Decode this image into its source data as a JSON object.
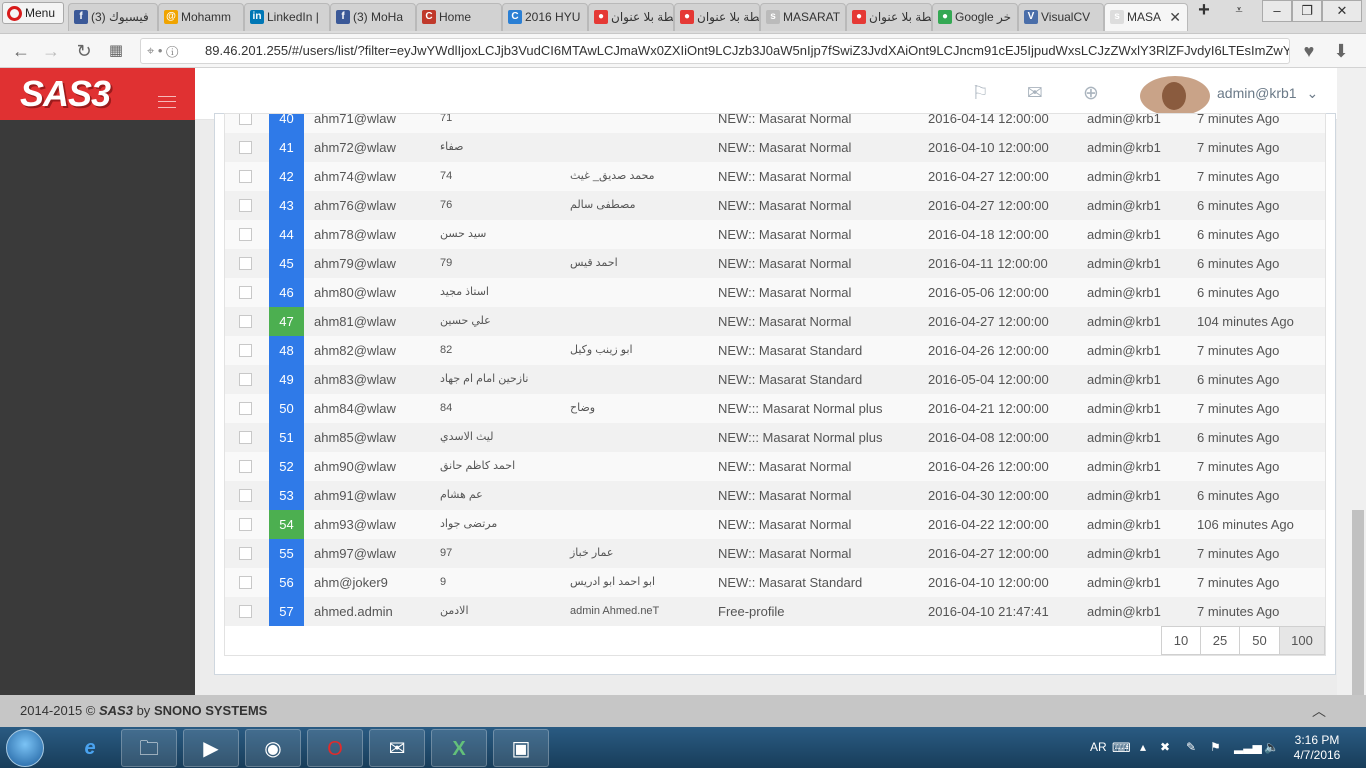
{
  "browser": {
    "menu_label": "Menu",
    "tabs": [
      {
        "title": "(3) فيسبوك",
        "icon": "facebook-icon",
        "color": "#3b5998",
        "glyph": "f"
      },
      {
        "title": "Mohamm",
        "icon": "at-icon",
        "color": "#f0a400",
        "glyph": "@"
      },
      {
        "title": "LinkedIn |",
        "icon": "linkedin-icon",
        "color": "#0077b5",
        "glyph": "in"
      },
      {
        "title": "(3) MoHa",
        "icon": "facebook-icon",
        "color": "#3b5998",
        "glyph": "f"
      },
      {
        "title": "Home",
        "icon": "cp-icon",
        "color": "#c0392b",
        "glyph": "C"
      },
      {
        "title": "2016 HYU",
        "icon": "c-icon",
        "color": "#2a7fd4",
        "glyph": "C"
      },
      {
        "title": "خريطة بلا عنوان",
        "icon": "map-pin-icon",
        "color": "#e53935",
        "glyph": "●"
      },
      {
        "title": "خريطة بلا عنوان",
        "icon": "map-pin-icon",
        "color": "#e53935",
        "glyph": "●"
      },
      {
        "title": "MASARAT",
        "icon": "sas-icon",
        "color": "#bbbbbb",
        "glyph": "s"
      },
      {
        "title": "خريطة بلا عنوان",
        "icon": "map-pin-icon",
        "color": "#e53935",
        "glyph": "●"
      },
      {
        "title": "Google خر",
        "icon": "google-maps-icon",
        "color": "#34a853",
        "glyph": "●"
      },
      {
        "title": "VisualCV",
        "icon": "visualcv-icon",
        "color": "#4a6ea9",
        "glyph": "V"
      },
      {
        "title": "MASA",
        "icon": "sas-icon",
        "color": "#dddddd",
        "glyph": "s"
      }
    ],
    "url": "89.46.201.255/#/users/list/?filter=eyJwYWdlIjoxLCJjb3VudCI6MTAwLCJmaWx0ZXIiOnt9LCJzb3J0aW5nIjp7fSwiZ3JvdXAiOnt9LCJncm91cEJ5IjpudWxsLCJzZWxlY3RlZFJvdyI6LTEsImZwYXJlbnQiO"
  },
  "app": {
    "logo": "SAS3",
    "username": "admin@krb1"
  },
  "colors": {
    "blue": "#2f7ae8",
    "green": "#4caf50"
  },
  "rows": [
    {
      "id": "40",
      "username": "ahm71@wlaw",
      "col3": "71",
      "col4": "",
      "profile": "NEW:: Masarat Normal",
      "expiration": "2016-04-14 12:00:00",
      "parent": "admin@krb1",
      "last": "7 minutes Ago",
      "status": "blue"
    },
    {
      "id": "41",
      "username": "ahm72@wlaw",
      "col3": "صفاء",
      "col4": "",
      "profile": "NEW:: Masarat Normal",
      "expiration": "2016-04-10 12:00:00",
      "parent": "admin@krb1",
      "last": "7 minutes Ago",
      "status": "blue"
    },
    {
      "id": "42",
      "username": "ahm74@wlaw",
      "col3": "74",
      "col4": "محمد صديق_ غيث",
      "profile": "NEW:: Masarat Normal",
      "expiration": "2016-04-27 12:00:00",
      "parent": "admin@krb1",
      "last": "7 minutes Ago",
      "status": "blue"
    },
    {
      "id": "43",
      "username": "ahm76@wlaw",
      "col3": "76",
      "col4": "مصطفى سالم",
      "profile": "NEW:: Masarat Normal",
      "expiration": "2016-04-27 12:00:00",
      "parent": "admin@krb1",
      "last": "6 minutes Ago",
      "status": "blue"
    },
    {
      "id": "44",
      "username": "ahm78@wlaw",
      "col3": "سيد حسن",
      "col4": "",
      "profile": "NEW:: Masarat Normal",
      "expiration": "2016-04-18 12:00:00",
      "parent": "admin@krb1",
      "last": "6 minutes Ago",
      "status": "blue"
    },
    {
      "id": "45",
      "username": "ahm79@wlaw",
      "col3": "79",
      "col4": "احمد قيس",
      "profile": "NEW:: Masarat Normal",
      "expiration": "2016-04-11 12:00:00",
      "parent": "admin@krb1",
      "last": "6 minutes Ago",
      "status": "blue"
    },
    {
      "id": "46",
      "username": "ahm80@wlaw",
      "col3": "استاذ مجيد",
      "col4": "",
      "profile": "NEW:: Masarat Normal",
      "expiration": "2016-05-06 12:00:00",
      "parent": "admin@krb1",
      "last": "6 minutes Ago",
      "status": "blue"
    },
    {
      "id": "47",
      "username": "ahm81@wlaw",
      "col3": "علي حسين",
      "col4": "",
      "profile": "NEW:: Masarat Normal",
      "expiration": "2016-04-27 12:00:00",
      "parent": "admin@krb1",
      "last": "104 minutes Ago",
      "status": "green"
    },
    {
      "id": "48",
      "username": "ahm82@wlaw",
      "col3": "82",
      "col4": "ابو زينب وكيل",
      "profile": "NEW:: Masarat Standard",
      "expiration": "2016-04-26 12:00:00",
      "parent": "admin@krb1",
      "last": "7 minutes Ago",
      "status": "blue"
    },
    {
      "id": "49",
      "username": "ahm83@wlaw",
      "col3": "نازحين امام ام جهاد",
      "col4": "",
      "profile": "NEW:: Masarat Standard",
      "expiration": "2016-05-04 12:00:00",
      "parent": "admin@krb1",
      "last": "6 minutes Ago",
      "status": "blue"
    },
    {
      "id": "50",
      "username": "ahm84@wlaw",
      "col3": "84",
      "col4": "وضاح",
      "profile": "NEW::: Masarat Normal plus",
      "expiration": "2016-04-21 12:00:00",
      "parent": "admin@krb1",
      "last": "7 minutes Ago",
      "status": "blue"
    },
    {
      "id": "51",
      "username": "ahm85@wlaw",
      "col3": "ليث الاسدي",
      "col4": "",
      "profile": "NEW::: Masarat Normal plus",
      "expiration": "2016-04-08 12:00:00",
      "parent": "admin@krb1",
      "last": "6 minutes Ago",
      "status": "blue"
    },
    {
      "id": "52",
      "username": "ahm90@wlaw",
      "col3": "احمد كاظم حانق",
      "col4": "",
      "profile": "NEW:: Masarat Normal",
      "expiration": "2016-04-26 12:00:00",
      "parent": "admin@krb1",
      "last": "7 minutes Ago",
      "status": "blue"
    },
    {
      "id": "53",
      "username": "ahm91@wlaw",
      "col3": "عم هشام",
      "col4": "",
      "profile": "NEW:: Masarat Normal",
      "expiration": "2016-04-30 12:00:00",
      "parent": "admin@krb1",
      "last": "6 minutes Ago",
      "status": "blue"
    },
    {
      "id": "54",
      "username": "ahm93@wlaw",
      "col3": "مرتضى جواد",
      "col4": "",
      "profile": "NEW:: Masarat Normal",
      "expiration": "2016-04-22 12:00:00",
      "parent": "admin@krb1",
      "last": "106 minutes Ago",
      "status": "green"
    },
    {
      "id": "55",
      "username": "ahm97@wlaw",
      "col3": "97",
      "col4": "عمار خباز",
      "profile": "NEW:: Masarat Normal",
      "expiration": "2016-04-27 12:00:00",
      "parent": "admin@krb1",
      "last": "7 minutes Ago",
      "status": "blue"
    },
    {
      "id": "56",
      "username": "ahm@joker9",
      "col3": "9",
      "col4": "ابو احمد ابو ادريس",
      "profile": "NEW:: Masarat Standard",
      "expiration": "2016-04-10 12:00:00",
      "parent": "admin@krb1",
      "last": "7 minutes Ago",
      "status": "blue"
    },
    {
      "id": "57",
      "username": "ahmed.admin",
      "col3": "الادمن",
      "col4": "admin Ahmed.neT",
      "profile": "Free-profile",
      "expiration": "2016-04-10 21:47:41",
      "parent": "admin@krb1",
      "last": "7 minutes Ago",
      "status": "blue"
    }
  ],
  "pager": {
    "sizes": [
      "10",
      "25",
      "50",
      "100"
    ],
    "selected": "100"
  },
  "footer": {
    "years": "2014-2015 ©",
    "logo": "SAS3",
    "by": "by",
    "company": "SNONO SYSTEMS"
  },
  "taskbar": {
    "lang": "AR",
    "time": "3:16 PM",
    "date": "4/7/2016"
  }
}
